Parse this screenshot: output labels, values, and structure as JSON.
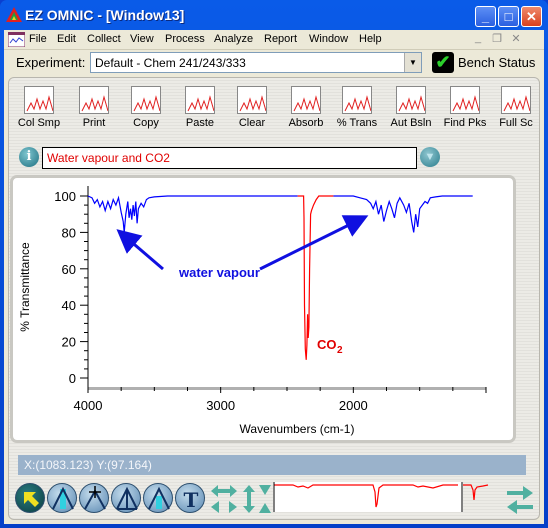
{
  "window": {
    "title": "EZ OMNIC - [Window13]"
  },
  "menu": [
    "File",
    "Edit",
    "Collect",
    "View",
    "Process",
    "Analyze",
    "Report",
    "Window",
    "Help"
  ],
  "experiment": {
    "label": "Experiment:",
    "value": "Default - Chem 241/243/333",
    "bench_status": "Bench Status"
  },
  "toolbar": [
    {
      "label": "Col Smp",
      "icon": "collect-sample-icon"
    },
    {
      "label": "Print",
      "icon": "printer-icon"
    },
    {
      "label": "Copy",
      "icon": "clipboard-copy-icon"
    },
    {
      "label": "Paste",
      "icon": "paste-icon"
    },
    {
      "label": "Clear",
      "icon": "clear-spectrum-icon"
    },
    {
      "label": "Absorb",
      "icon": "absorbance-icon"
    },
    {
      "label": "% Trans",
      "icon": "transmittance-icon"
    },
    {
      "label": "Aut Bsln",
      "icon": "auto-baseline-icon"
    },
    {
      "label": "Find Pks",
      "icon": "find-peaks-icon"
    },
    {
      "label": "Full Sc",
      "icon": "full-scale-icon"
    }
  ],
  "spectrum_title": "Water vapour and CO2",
  "status": "X:(1083.123) Y:(97.164)",
  "colors": {
    "water": "#0000ff",
    "co2": "#ff0000",
    "status_bar": "#9ab2cb"
  },
  "chart_data": {
    "type": "line",
    "xlabel": "Wavenumbers (cm-1)",
    "ylabel": "% Transmittance",
    "xlim": [
      4000,
      1000
    ],
    "ylim": [
      0,
      100
    ],
    "xticks": [
      "4000",
      "3000",
      "2000"
    ],
    "yticks": [
      "100",
      "80",
      "60",
      "40",
      "20",
      "0"
    ],
    "annotations": {
      "water": "water vapour",
      "co2": "CO",
      "co2_sub": "2"
    },
    "series": [
      {
        "color": "#0000ff",
        "points": [
          [
            4000,
            100
          ],
          [
            3970,
            99
          ],
          [
            3950,
            96
          ],
          [
            3930,
            98
          ],
          [
            3910,
            94
          ],
          [
            3890,
            97
          ],
          [
            3870,
            92
          ],
          [
            3850,
            97
          ],
          [
            3830,
            93
          ],
          [
            3810,
            98
          ],
          [
            3790,
            95
          ],
          [
            3770,
            99
          ],
          [
            3750,
            91
          ],
          [
            3735,
            86
          ],
          [
            3727,
            80
          ],
          [
            3715,
            90
          ],
          [
            3700,
            97
          ],
          [
            3690,
            88
          ],
          [
            3680,
            93
          ],
          [
            3670,
            87
          ],
          [
            3660,
            95
          ],
          [
            3650,
            89
          ],
          [
            3640,
            97
          ],
          [
            3630,
            85
          ],
          [
            3620,
            93
          ],
          [
            3600,
            96
          ],
          [
            3580,
            94
          ],
          [
            3560,
            98
          ],
          [
            3540,
            99
          ],
          [
            3500,
            99.5
          ],
          [
            3400,
            100
          ],
          [
            3000,
            100
          ],
          [
            2420,
            100
          ]
        ]
      },
      {
        "color": "#ff0000",
        "points": [
          [
            2420,
            100
          ],
          [
            2375,
            100
          ],
          [
            2372,
            88
          ],
          [
            2368,
            40
          ],
          [
            2362,
            16
          ],
          [
            2355,
            10
          ],
          [
            2350,
            18
          ],
          [
            2345,
            35
          ],
          [
            2340,
            22
          ],
          [
            2335,
            28
          ],
          [
            2330,
            60
          ],
          [
            2322,
            90
          ],
          [
            2315,
            92
          ],
          [
            2300,
            95
          ],
          [
            2280,
            98
          ],
          [
            2260,
            100
          ],
          [
            2150,
            100
          ]
        ]
      },
      {
        "color": "#0000ff",
        "points": [
          [
            2150,
            100
          ],
          [
            2000,
            100
          ],
          [
            1950,
            99
          ],
          [
            1900,
            98
          ],
          [
            1870,
            96
          ],
          [
            1850,
            93
          ],
          [
            1830,
            97
          ],
          [
            1810,
            90
          ],
          [
            1790,
            95
          ],
          [
            1770,
            86
          ],
          [
            1750,
            92
          ],
          [
            1730,
            97
          ],
          [
            1710,
            93
          ],
          [
            1690,
            88
          ],
          [
            1670,
            96
          ],
          [
            1650,
            99
          ],
          [
            1620,
            95
          ],
          [
            1600,
            91
          ],
          [
            1580,
            96
          ],
          [
            1560,
            86
          ],
          [
            1545,
            80
          ],
          [
            1530,
            90
          ],
          [
            1515,
            83
          ],
          [
            1500,
            93
          ],
          [
            1480,
            95
          ],
          [
            1460,
            97
          ],
          [
            1440,
            96
          ],
          [
            1420,
            99
          ],
          [
            1380,
            99.5
          ],
          [
            1330,
            100
          ],
          [
            1100,
            100
          ]
        ]
      }
    ]
  }
}
